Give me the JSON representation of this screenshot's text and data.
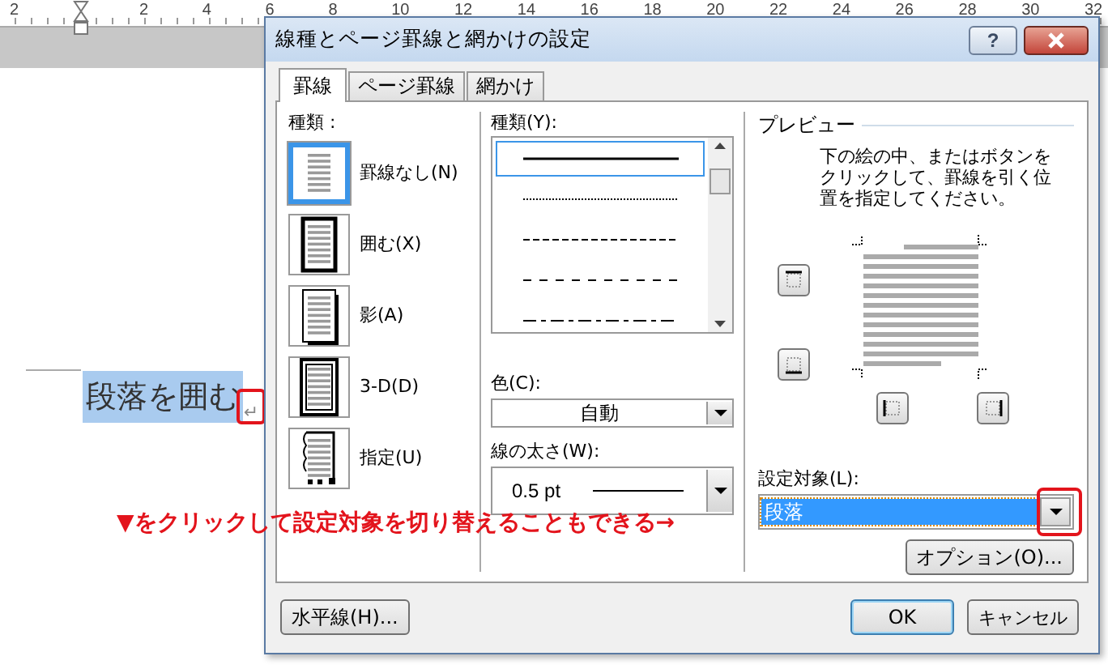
{
  "ruler": {
    "labels": [
      "2",
      "2",
      "4",
      "6",
      "8",
      "10",
      "12",
      "14",
      "16",
      "18",
      "20",
      "22",
      "24",
      "26",
      "28",
      "30",
      "32"
    ]
  },
  "document": {
    "text": "段落を囲む",
    "selected": true,
    "mark": "↵"
  },
  "dialog": {
    "title": "線種とページ罫線と網かけの設定",
    "help_button": "?",
    "tabs": [
      {
        "label": "罫線",
        "selected": true
      },
      {
        "label": "ページ罫線",
        "selected": false
      },
      {
        "label": "網かけ",
        "selected": false
      }
    ],
    "setting": {
      "label": "種類 :",
      "options": [
        {
          "kind": "none",
          "label": "罫線なし(N)",
          "selected": true
        },
        {
          "kind": "box",
          "label": "囲む(X)",
          "selected": false
        },
        {
          "kind": "shadow",
          "label": "影(A)",
          "selected": false
        },
        {
          "kind": "frame",
          "label": "3-D(D)",
          "selected": false
        },
        {
          "kind": "custom",
          "label": "指定(U)",
          "selected": false
        }
      ]
    },
    "style": {
      "label": "種類(Y):",
      "lines": [
        {
          "kind": "solid",
          "selected": true
        },
        {
          "kind": "dotted",
          "selected": false
        },
        {
          "kind": "dashed",
          "selected": false
        },
        {
          "kind": "long-dashed",
          "selected": false
        },
        {
          "kind": "dash-dot",
          "selected": false
        }
      ]
    },
    "color": {
      "label": "色(C):",
      "value": "自動"
    },
    "width": {
      "label": "線の太さ(W):",
      "value": "0.5 pt"
    },
    "preview": {
      "title": "プレビュー",
      "instructions": "下の絵の中、またはボタンをクリックして、罫線を引く位置を指定してください。",
      "buttons": [
        {
          "kind": "top"
        },
        {
          "kind": "bottom"
        },
        {
          "kind": "left"
        },
        {
          "kind": "right"
        }
      ]
    },
    "apply_to": {
      "label": "設定対象(L):",
      "value": "段落"
    },
    "options_button": "オプション(O)...",
    "horizontal_line_button": "水平線(H)...",
    "ok_button": "OK",
    "cancel_button": "キャンセル"
  },
  "annotation": {
    "text": "▼をクリックして設定対象を切り替えることもできる→"
  }
}
